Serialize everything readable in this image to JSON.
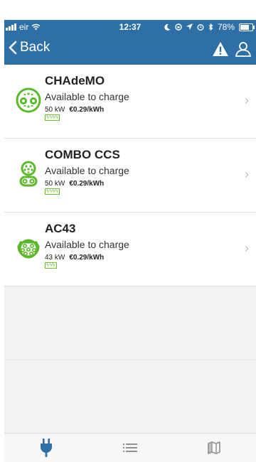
{
  "status_bar": {
    "carrier": "eir",
    "time": "12:37",
    "battery": "78%",
    "battery_level": 0.78
  },
  "nav": {
    "back_label": "Back"
  },
  "colors": {
    "header": "#2e6fa5",
    "connector_green": "#5cb82a",
    "tab_active": "#2e6fa5",
    "tab_inactive": "#8e8e93"
  },
  "connectors": [
    {
      "name": "CHAdeMO",
      "status": "Available to charge",
      "power": "50 kW",
      "price": "€0.29/kWh",
      "speed_badge": "ϟϟϟϟ",
      "icon": "chademo-plug-icon"
    },
    {
      "name": "COMBO CCS",
      "status": "Available to charge",
      "power": "50 kW",
      "price": "€0.29/kWh",
      "speed_badge": "ϟϟϟϟ",
      "icon": "ccs-plug-icon"
    },
    {
      "name": "AC43",
      "status": "Available to charge",
      "power": "43 kW",
      "price": "€0.29/kWh",
      "speed_badge": "ϟϟϟ",
      "icon": "type2-plug-icon"
    }
  ],
  "tabs": [
    {
      "icon": "plug-icon",
      "active": true
    },
    {
      "icon": "list-icon",
      "active": false
    },
    {
      "icon": "map-icon",
      "active": false
    }
  ]
}
